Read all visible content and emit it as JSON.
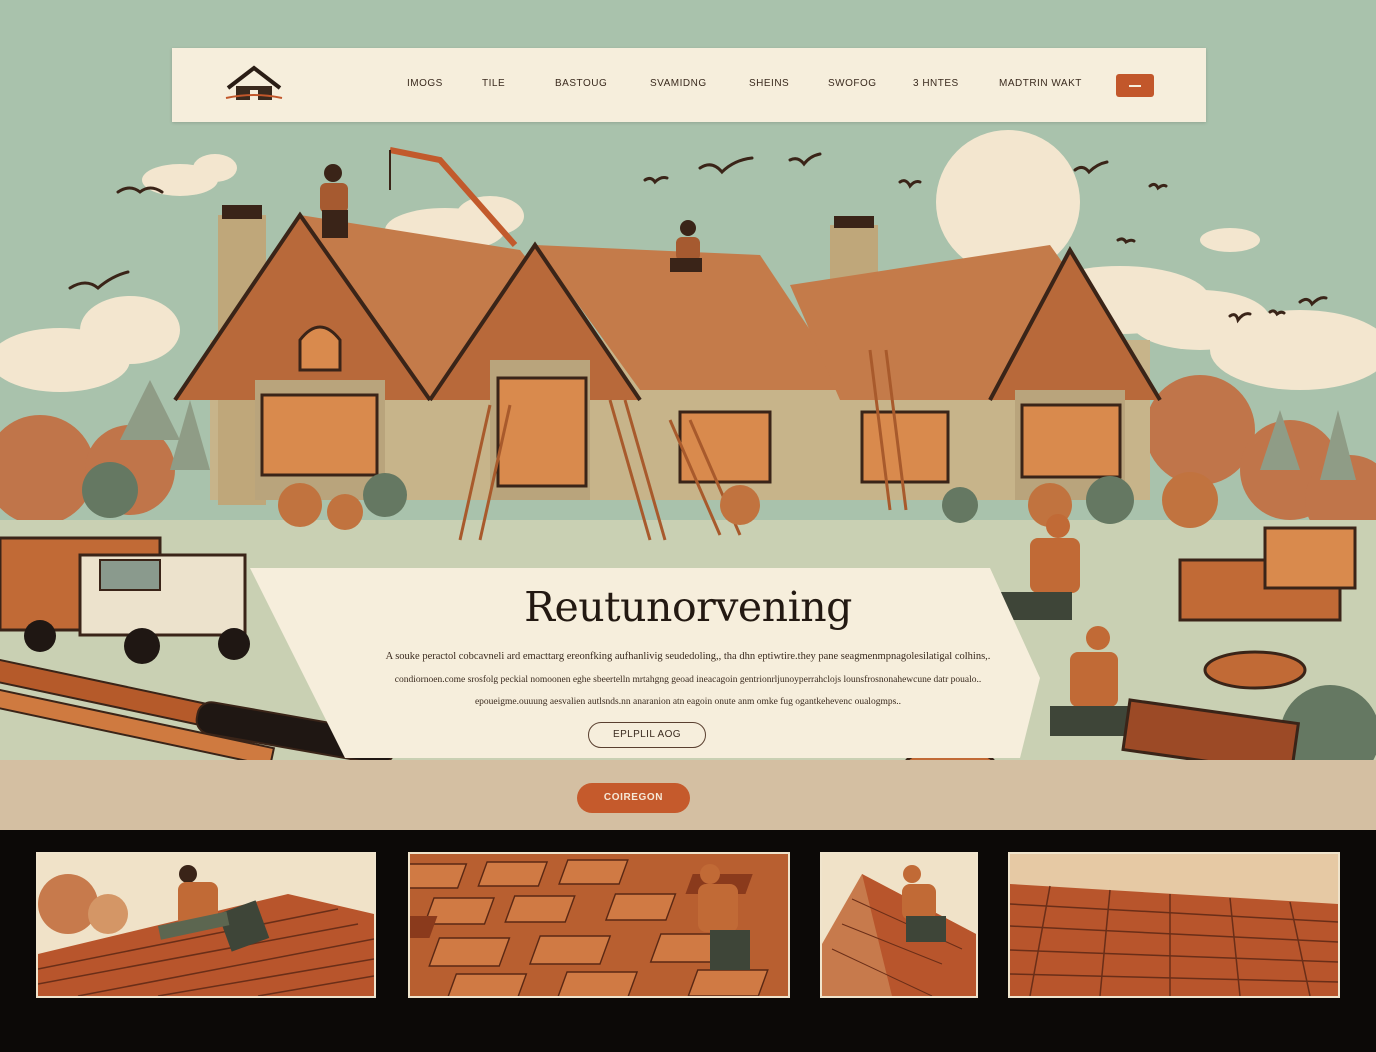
{
  "hero": {
    "title": "Reutunorvening",
    "body_lines": [
      "A souke peractol cobcavneli ard emacttarg ereonfking aufhanlivig seudedoling,, tha dhn eptiwtire.they pane seagmenmpnagolesilatigal colhins,.",
      "condiornoen.come srosfolg peckial nomoonen eghe sbeertelln mrtahgng geoad ineacagoin gentrionrljunoyperrahclojs lounsfrosnonahewcune datr poualo..",
      "epoueigme.ouuung aesvalien autlsnds.nn anaranion atn eagoin onute anm omke fug ogantkehevenc oualogmps.."
    ],
    "outline_button": "EPLPLIL AOG",
    "cta_button": "COIREGON"
  },
  "nav": {
    "items": [
      "IMOGS",
      "TILE",
      "BASTOUG",
      "SVAMIDNG",
      "SHEINS",
      "SWOFOG",
      "3 HNTES",
      "MADTRIN WAKT"
    ],
    "button": "menu-button"
  },
  "gallery": {
    "photos": [
      "roofer-laying-shingles",
      "roof-shingle-texture",
      "roofer-kneeling-on-roof",
      "shingle-roof-surface"
    ]
  },
  "colors": {
    "sky": "#a9c2ac",
    "cream": "#f6eedc",
    "accent": "#c55a2c",
    "dark": "#231912",
    "band": "#d4bfa2",
    "gallery_bg": "#0c0907"
  }
}
